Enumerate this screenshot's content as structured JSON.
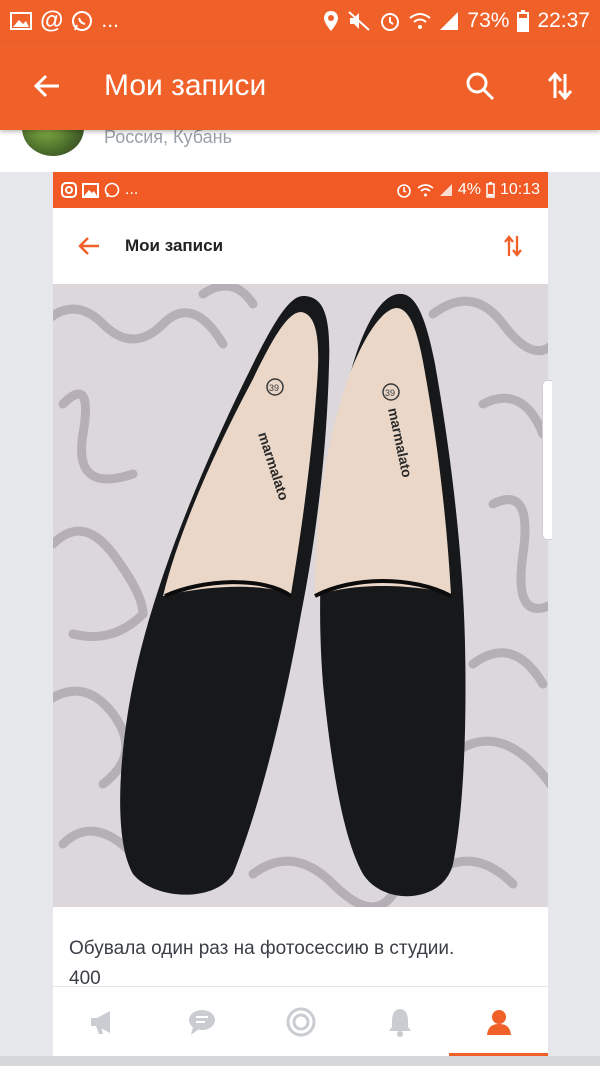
{
  "status_bar": {
    "left_icons": [
      "image-icon",
      "at-icon",
      "whatsapp-icon"
    ],
    "more": "...",
    "battery": "73%",
    "time": "22:37"
  },
  "app_bar": {
    "title": "Мои записи",
    "color": "#ef6128"
  },
  "profile": {
    "location": "Россия, Кубань"
  },
  "post_screenshot": {
    "status_bar": {
      "more": "...",
      "battery": "4%",
      "time": "10:13"
    },
    "app_bar": {
      "title": "Мои записи"
    },
    "photo": {
      "brand": "marmalato",
      "size": "39"
    }
  },
  "post": {
    "caption_line1": "Обувала один раз на фотосессию в студии.",
    "caption_line2": "400"
  },
  "tabs": [
    {
      "name": "megaphone-icon",
      "active": false
    },
    {
      "name": "chat-icon",
      "active": false
    },
    {
      "name": "target-icon",
      "active": false
    },
    {
      "name": "bell-icon",
      "active": false
    },
    {
      "name": "profile-icon",
      "active": true
    }
  ],
  "colors": {
    "accent": "#f0612a",
    "tab_inactive": "#c9ccd0"
  }
}
